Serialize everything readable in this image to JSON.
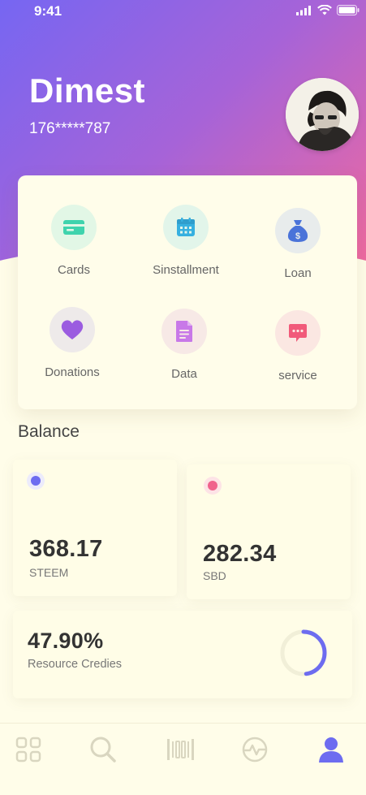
{
  "status": {
    "time": "9:41"
  },
  "profile": {
    "name": "Dimest",
    "phone": "176*****787"
  },
  "menu": {
    "items": [
      {
        "label": "Cards",
        "icon": "card-icon",
        "color": "#4fd5b0",
        "bg": "#e2f7e6"
      },
      {
        "label": "Sinstallment",
        "icon": "calendar-icon",
        "color": "#3cb3e0",
        "bg": "#e2f5ea"
      },
      {
        "label": "Loan",
        "icon": "money-bag-icon",
        "color": "#4a73d9",
        "bg": "#e8ecec"
      },
      {
        "label": "Donations",
        "icon": "heart-icon",
        "color": "#9b5ce0",
        "bg": "#eeeaea"
      },
      {
        "label": "Data",
        "icon": "document-icon",
        "color": "#c878e8",
        "bg": "#f7e9e6"
      },
      {
        "label": "service",
        "icon": "chat-icon",
        "color": "#f15a7a",
        "bg": "#fbe7e2"
      }
    ]
  },
  "balance": {
    "title": "Balance",
    "steem": {
      "value": "368.17",
      "unit": "STEEM",
      "color": "#6d6cf0"
    },
    "sbd": {
      "value": "282.34",
      "unit": "SBD",
      "color": "#f0628c"
    }
  },
  "resource": {
    "value": "47.90%",
    "label": "Resource Credies",
    "fraction": 0.479,
    "color": "#6d6cf0"
  },
  "tabbar": {
    "items": [
      {
        "icon": "grid-icon"
      },
      {
        "icon": "search-icon"
      },
      {
        "icon": "barcode-icon"
      },
      {
        "icon": "activity-icon"
      },
      {
        "icon": "user-icon",
        "active": true
      }
    ],
    "active_color": "#6d6cf0",
    "inactive_color": "#d9d6c0"
  }
}
